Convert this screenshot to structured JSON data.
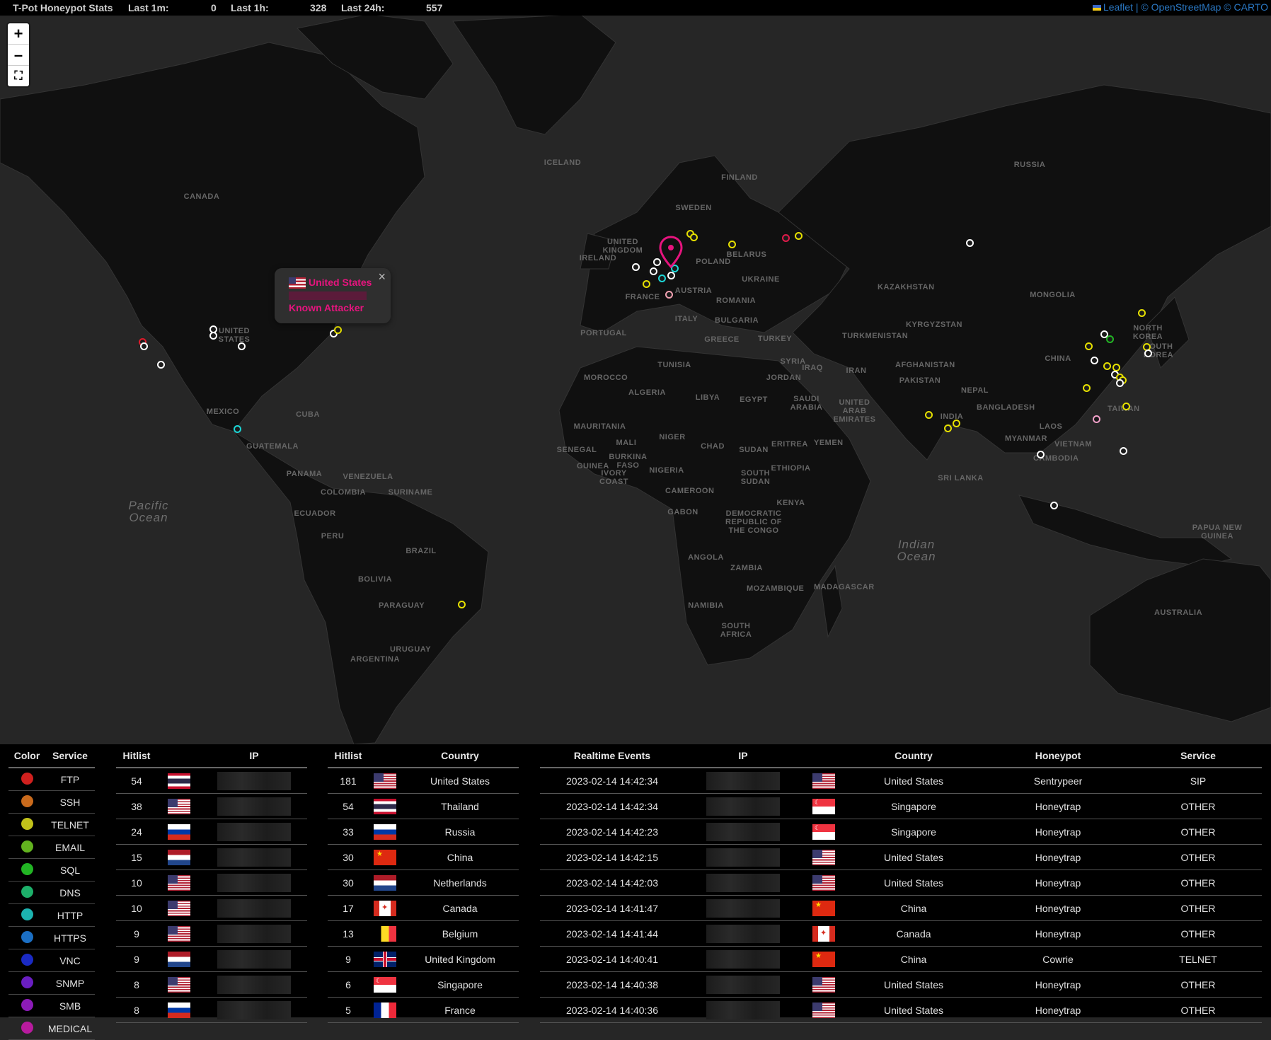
{
  "topbar": {
    "title": "T-Pot Honeypot Stats",
    "last1m_label": "Last 1m:",
    "last1m_value": "0",
    "last1h_label": "Last 1h:",
    "last1h_value": "328",
    "last24h_label": "Last 24h:",
    "last24h_value": "557"
  },
  "attribution": "Leaflet | © OpenStreetMap © CARTO",
  "zoom": {
    "in": "+",
    "out": "–",
    "fullscreen": "⛶"
  },
  "popup": {
    "country": "United States",
    "status": "Known Attacker",
    "close": "×"
  },
  "map_labels": [
    "CANADA",
    "UNITED STATES",
    "MEXICO",
    "CUBA",
    "GUATEMALA",
    "PANAMA",
    "VENEZUELA",
    "COLOMBIA",
    "SURINAME",
    "ECUADOR",
    "PERU",
    "BRAZIL",
    "BOLIVIA",
    "PARAGUAY",
    "URUGUAY",
    "ARGENTINA",
    "ICELAND",
    "FINLAND",
    "SWEDEN",
    "UNITED KINGDOM",
    "IRELAND",
    "FRANCE",
    "AUSTRIA",
    "POLAND",
    "BELARUS",
    "UKRAINE",
    "ROMANIA",
    "BULGARIA",
    "ITALY",
    "PORTUGAL",
    "GREECE",
    "TURKEY",
    "MOROCCO",
    "TUNISIA",
    "ALGERIA",
    "LIBYA",
    "EGYPT",
    "SYRIA",
    "IRAQ",
    "JORDAN",
    "IRAN",
    "SAUDI ARABIA",
    "UNITED ARAB EMIRATES",
    "YEMEN",
    "MAURITANIA",
    "MALI",
    "NIGER",
    "CHAD",
    "SUDAN",
    "ERITREA",
    "ETHIOPIA",
    "SENEGAL",
    "GUINEA",
    "BURKINA FASO",
    "IVORY COAST",
    "NIGERIA",
    "CAMEROON",
    "GABON",
    "DEMOCRATIC REPUBLIC OF THE CONGO",
    "SOUTH SUDAN",
    "KENYA",
    "ANGOLA",
    "ZAMBIA",
    "NAMIBIA",
    "MOZAMBIQUE",
    "SOUTH AFRICA",
    "MADAGASCAR",
    "RUSSIA",
    "KAZAKHSTAN",
    "MONGOLIA",
    "TURKMENISTAN",
    "KYRGYZSTAN",
    "AFGHANISTAN",
    "PAKISTAN",
    "NEPAL",
    "INDIA",
    "BANGLADESH",
    "SRI LANKA",
    "CHINA",
    "NORTH KOREA",
    "SOUTH KOREA",
    "TAIWAN",
    "MYANMAR",
    "LAOS",
    "VIETNAM",
    "CAMBODIA",
    "PAPUA NEW GUINEA",
    "AUSTRALIA"
  ],
  "oceans": [
    "Pacific Ocean",
    "Indian Ocean"
  ],
  "services": [
    {
      "name": "FTP",
      "color": "#d0201e"
    },
    {
      "name": "SSH",
      "color": "#c96a1c"
    },
    {
      "name": "TELNET",
      "color": "#c2c21a"
    },
    {
      "name": "EMAIL",
      "color": "#62b31f"
    },
    {
      "name": "SQL",
      "color": "#22b524"
    },
    {
      "name": "DNS",
      "color": "#1db06a"
    },
    {
      "name": "HTTP",
      "color": "#1cb3b0"
    },
    {
      "name": "HTTPS",
      "color": "#1b6fc4"
    },
    {
      "name": "VNC",
      "color": "#1a2ac4"
    },
    {
      "name": "SNMP",
      "color": "#6a1ec2"
    },
    {
      "name": "SMB",
      "color": "#8c1bb8"
    },
    {
      "name": "MEDICAL",
      "color": "#b81b9e"
    }
  ],
  "service_headers": {
    "color": "Color",
    "service": "Service"
  },
  "ip_hitlist": {
    "headers": {
      "hits": "Hitlist",
      "ip": "IP"
    },
    "rows": [
      {
        "hits": "54",
        "flag": "TH"
      },
      {
        "hits": "38",
        "flag": "US"
      },
      {
        "hits": "24",
        "flag": "RU"
      },
      {
        "hits": "15",
        "flag": "NL"
      },
      {
        "hits": "10",
        "flag": "US"
      },
      {
        "hits": "10",
        "flag": "US"
      },
      {
        "hits": "9",
        "flag": "US"
      },
      {
        "hits": "9",
        "flag": "NL"
      },
      {
        "hits": "8",
        "flag": "US"
      },
      {
        "hits": "8",
        "flag": "RU"
      }
    ]
  },
  "country_hitlist": {
    "headers": {
      "hits": "Hitlist",
      "country": "Country"
    },
    "rows": [
      {
        "hits": "181",
        "flag": "US",
        "country": "United States"
      },
      {
        "hits": "54",
        "flag": "TH",
        "country": "Thailand"
      },
      {
        "hits": "33",
        "flag": "RU",
        "country": "Russia"
      },
      {
        "hits": "30",
        "flag": "CN",
        "country": "China"
      },
      {
        "hits": "30",
        "flag": "NL",
        "country": "Netherlands"
      },
      {
        "hits": "17",
        "flag": "CA",
        "country": "Canada"
      },
      {
        "hits": "13",
        "flag": "BE",
        "country": "Belgium"
      },
      {
        "hits": "9",
        "flag": "GB",
        "country": "United Kingdom"
      },
      {
        "hits": "6",
        "flag": "SG",
        "country": "Singapore"
      },
      {
        "hits": "5",
        "flag": "FR",
        "country": "France"
      }
    ]
  },
  "events": {
    "headers": {
      "time": "Realtime Events",
      "ip": "IP",
      "country": "Country",
      "honeypot": "Honeypot",
      "service": "Service"
    },
    "rows": [
      {
        "time": "2023-02-14 14:42:34",
        "flag": "US",
        "country": "United States",
        "honeypot": "Sentrypeer",
        "service": "SIP"
      },
      {
        "time": "2023-02-14 14:42:34",
        "flag": "SG",
        "country": "Singapore",
        "honeypot": "Honeytrap",
        "service": "OTHER"
      },
      {
        "time": "2023-02-14 14:42:23",
        "flag": "SG",
        "country": "Singapore",
        "honeypot": "Honeytrap",
        "service": "OTHER"
      },
      {
        "time": "2023-02-14 14:42:15",
        "flag": "US",
        "country": "United States",
        "honeypot": "Honeytrap",
        "service": "OTHER"
      },
      {
        "time": "2023-02-14 14:42:03",
        "flag": "US",
        "country": "United States",
        "honeypot": "Honeytrap",
        "service": "OTHER"
      },
      {
        "time": "2023-02-14 14:41:47",
        "flag": "CN",
        "country": "China",
        "honeypot": "Honeytrap",
        "service": "OTHER"
      },
      {
        "time": "2023-02-14 14:41:44",
        "flag": "CA",
        "country": "Canada",
        "honeypot": "Honeytrap",
        "service": "OTHER"
      },
      {
        "time": "2023-02-14 14:40:41",
        "flag": "CN",
        "country": "China",
        "honeypot": "Cowrie",
        "service": "TELNET"
      },
      {
        "time": "2023-02-14 14:40:38",
        "flag": "US",
        "country": "United States",
        "honeypot": "Honeytrap",
        "service": "OTHER"
      },
      {
        "time": "2023-02-14 14:40:36",
        "flag": "US",
        "country": "United States",
        "honeypot": "Honeytrap",
        "service": "OTHER"
      }
    ]
  },
  "colors": {
    "accent": "#e6147e",
    "marker_yellow": "#e6e000",
    "marker_white": "#ffffff",
    "marker_cyan": "#1bd6d6",
    "marker_red": "#e01a4a"
  }
}
